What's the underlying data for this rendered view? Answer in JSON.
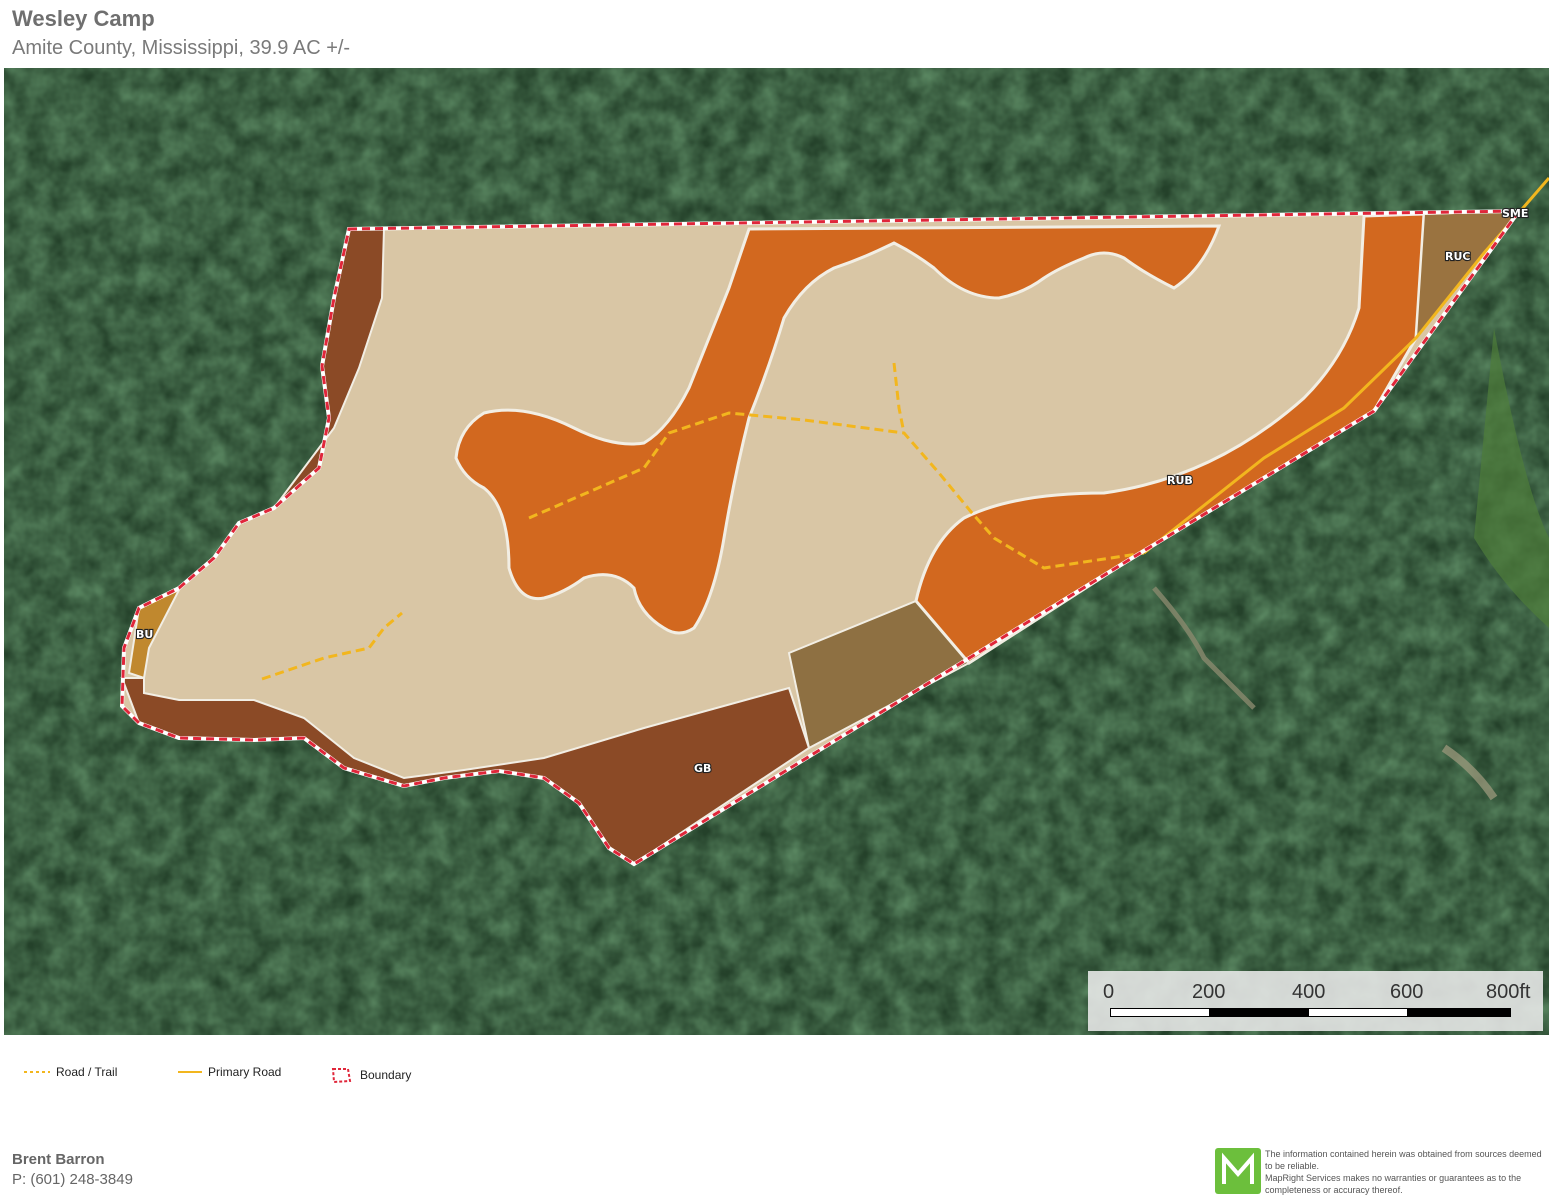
{
  "header": {
    "title": "Wesley Camp",
    "subtitle": "Amite County, Mississippi, 39.9 AC +/-"
  },
  "map": {
    "soil_labels": [
      "BU",
      "GB",
      "RUB",
      "RUC",
      "SME"
    ],
    "scale": {
      "ticks": [
        "0",
        "200",
        "400",
        "600",
        "800ft"
      ]
    },
    "colors": {
      "forest": "#24412a",
      "light_soil": "#d9c6a5",
      "orange_soil": "#d2681f",
      "brown_soil": "#8b4a26",
      "olive_soil": "#8e7042",
      "tan_soil": "#9a7340",
      "gold_soil": "#c0882e",
      "boundary": "#e0263a",
      "road": "#f2b61e"
    }
  },
  "legend": {
    "road_trail": "Road / Trail",
    "primary_road": "Primary Road",
    "boundary": "Boundary"
  },
  "footer": {
    "agent_name": "Brent Barron",
    "agent_phone": "P: (601) 248-3849",
    "disclaimer_1": "The information contained herein was obtained from sources deemed to be reliable.",
    "disclaimer_2": "MapRight Services makes no warranties or guarantees as to the completeness or accuracy thereof."
  }
}
